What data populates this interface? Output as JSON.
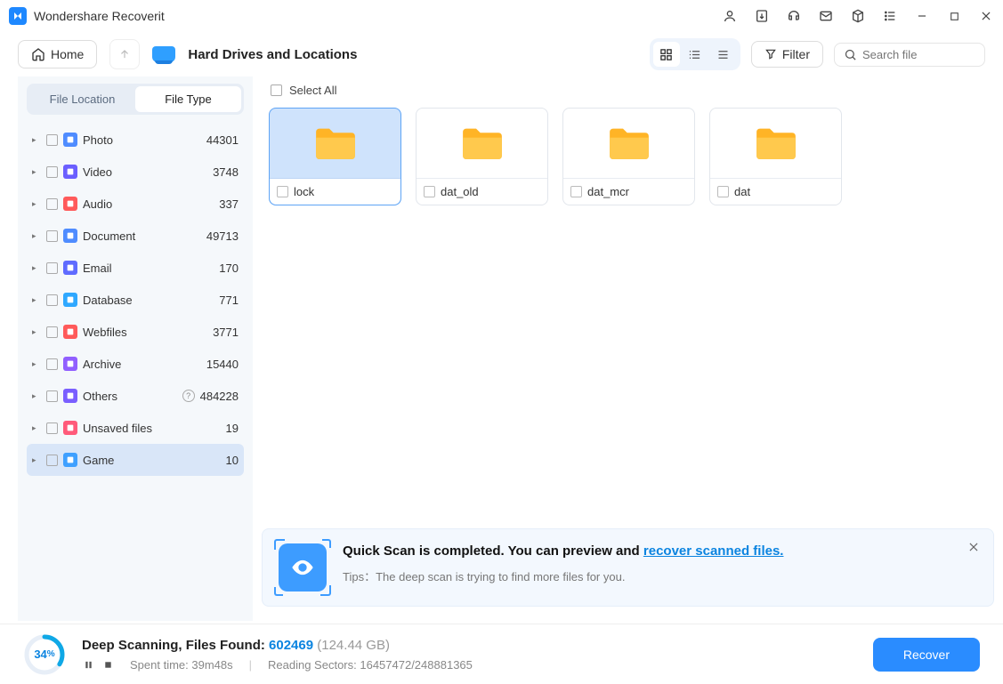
{
  "app_title": "Wondershare Recoverit",
  "toolbar": {
    "home_label": "Home",
    "breadcrumb": "Hard Drives and Locations",
    "filter_label": "Filter",
    "search_placeholder": "Search file"
  },
  "sidebar": {
    "tabs": {
      "location": "File Location",
      "type": "File Type"
    },
    "categories": [
      {
        "label": "Photo",
        "count": "44301",
        "color": "#4f8cff"
      },
      {
        "label": "Video",
        "count": "3748",
        "color": "#6b5fff"
      },
      {
        "label": "Audio",
        "count": "337",
        "color": "#ff5a5a"
      },
      {
        "label": "Document",
        "count": "49713",
        "color": "#4f8cff"
      },
      {
        "label": "Email",
        "count": "170",
        "color": "#5f6bff"
      },
      {
        "label": "Database",
        "count": "771",
        "color": "#2fa8ff"
      },
      {
        "label": "Webfiles",
        "count": "3771",
        "color": "#ff5a5a"
      },
      {
        "label": "Archive",
        "count": "15440",
        "color": "#915fff"
      },
      {
        "label": "Others",
        "count": "484228",
        "color": "#7a5fff",
        "help": true
      },
      {
        "label": "Unsaved files",
        "count": "19",
        "color": "#ff5a7a"
      },
      {
        "label": "Game",
        "count": "10",
        "color": "#3fa0ff",
        "active": true
      }
    ]
  },
  "content": {
    "select_all": "Select All",
    "folders": [
      {
        "name": "lock",
        "selected": true
      },
      {
        "name": "dat_old",
        "selected": false
      },
      {
        "name": "dat_mcr",
        "selected": false
      },
      {
        "name": "dat",
        "selected": false
      }
    ]
  },
  "notice": {
    "title_prefix": "Quick Scan is completed. You can preview and ",
    "link": "recover scanned files.",
    "tips_label": "Tips：",
    "tips_text": "The deep scan is trying to find more files for you."
  },
  "footer": {
    "percent": "34",
    "percent_sym": "%",
    "status_prefix": "Deep Scanning, Files Found: ",
    "file_count": "602469",
    "size": "(124.44 GB)",
    "spent_label": "Spent time: ",
    "spent": "39m48s",
    "sectors_label": "Reading Sectors: ",
    "sectors": "16457472/248881365",
    "recover_label": "Recover"
  }
}
